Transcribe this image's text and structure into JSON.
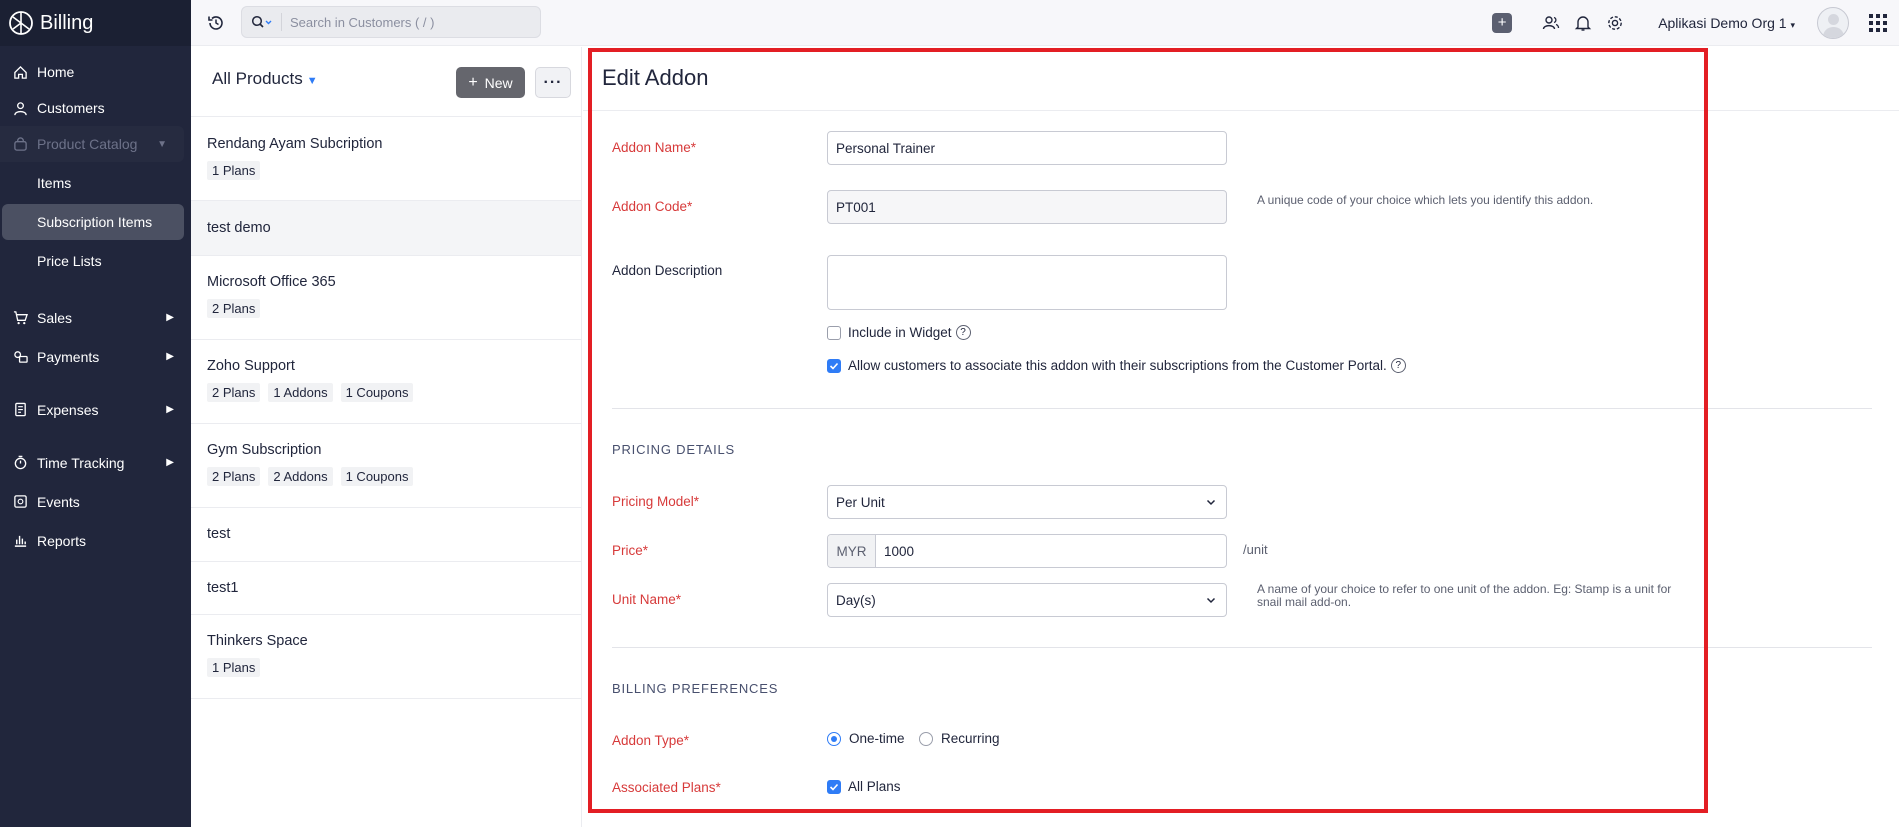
{
  "app": {
    "name": "Billing"
  },
  "sidebar": {
    "items": [
      {
        "label": "Home",
        "icon": "home-icon"
      },
      {
        "label": "Customers",
        "icon": "user-icon"
      },
      {
        "label": "Product Catalog",
        "icon": "bag-icon"
      }
    ],
    "catalog_sub": [
      {
        "label": "Items"
      },
      {
        "label": "Subscription Items"
      },
      {
        "label": "Price Lists"
      }
    ],
    "groups": [
      {
        "label": "Sales",
        "icon": "cart-icon"
      },
      {
        "label": "Payments",
        "icon": "payments-icon"
      },
      {
        "label": "Expenses",
        "icon": "receipt-icon"
      },
      {
        "label": "Time Tracking",
        "icon": "timer-icon"
      },
      {
        "label": "Events",
        "icon": "calendar-icon"
      },
      {
        "label": "Reports",
        "icon": "reports-icon"
      }
    ]
  },
  "topbar": {
    "search_placeholder": "Search in Customers ( / )",
    "org_name": "Aplikasi Demo Org 1"
  },
  "products": {
    "title": "All Products",
    "new_label": "New",
    "list": [
      {
        "name": "Rendang Ayam Subcription",
        "tags": [
          "1 Plans"
        ]
      },
      {
        "name": "test demo",
        "tags": []
      },
      {
        "name": "Microsoft Office 365",
        "tags": [
          "2 Plans"
        ]
      },
      {
        "name": "Zoho Support",
        "tags": [
          "2 Plans",
          "1 Addons",
          "1 Coupons"
        ]
      },
      {
        "name": "Gym Subscription",
        "tags": [
          "2 Plans",
          "2 Addons",
          "1 Coupons"
        ]
      },
      {
        "name": "test",
        "tags": []
      },
      {
        "name": "test1",
        "tags": []
      },
      {
        "name": "Thinkers Space",
        "tags": [
          "1 Plans"
        ]
      }
    ]
  },
  "form": {
    "title": "Edit Addon",
    "addon_name_label": "Addon Name*",
    "addon_name_value": "Personal Trainer",
    "addon_code_label": "Addon Code*",
    "addon_code_value": "PT001",
    "addon_code_hint": "A unique code of your choice which lets you identify this addon.",
    "description_label": "Addon Description",
    "include_widget_label": "Include in Widget",
    "portal_label": "Allow customers to associate this addon with their subscriptions from the Customer Portal.",
    "pricing_section": "PRICING DETAILS",
    "pricing_model_label": "Pricing Model*",
    "pricing_model_value": "Per Unit",
    "price_label": "Price*",
    "currency": "MYR",
    "price_value": "1000",
    "per_unit": "/unit",
    "unit_name_label": "Unit Name*",
    "unit_name_value": "Day(s)",
    "unit_name_hint": "A name of your choice to refer to one unit of the addon. Eg: Stamp is a unit for snail mail add-on.",
    "billing_section": "BILLING PREFERENCES",
    "addon_type_label": "Addon Type*",
    "type_onetime": "One-time",
    "type_recurring": "Recurring",
    "associated_plans_label": "Associated Plans*",
    "all_plans_label": "All Plans"
  },
  "colors": {
    "sidebar_bg": "#21263c",
    "accent": "#2f7cf6",
    "required": "#d73a3a",
    "highlight_frame": "#e31e24"
  }
}
